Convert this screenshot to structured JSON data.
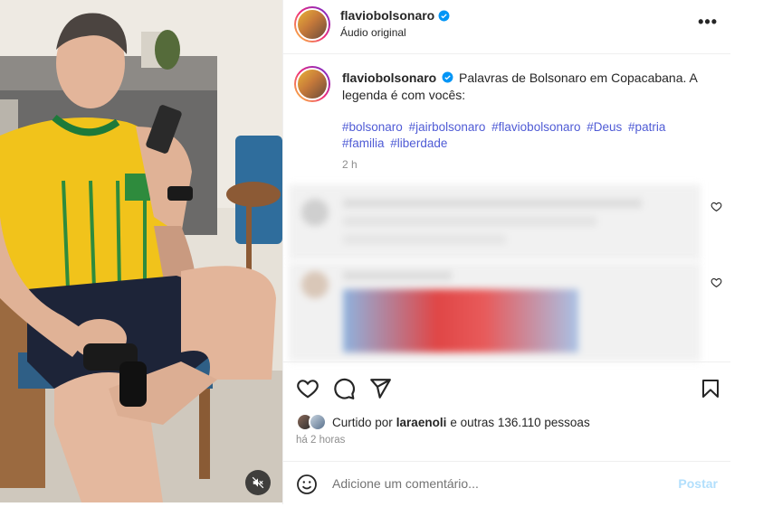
{
  "post": {
    "username": "flaviobolsonaro",
    "audio_label": "Áudio original",
    "more_label": "•••",
    "caption_text": "Palavras de Bolsonaro em Copacabana. A legenda é com vocês:",
    "hashtags": [
      "#bolsonaro",
      "#jairbolsonaro",
      "#flaviobolsonaro",
      "#Deus",
      "#patria",
      "#familia",
      "#liberdade"
    ],
    "caption_time": "2 h",
    "likes": {
      "prefix": "Curtido por",
      "user": "laraenoli",
      "suffix": "e outras 136.110 pessoas"
    },
    "posted_ago": "há 2 horas",
    "comment_placeholder": "Adicione um comentário...",
    "post_label": "Postar"
  },
  "colors": {
    "hashtag": "#4f5bd5",
    "verified": "#0095f6",
    "post_disabled": "#b2dffc",
    "secondary_text": "#8e8e8e"
  },
  "icons": [
    "verified-icon",
    "more-icon",
    "heart-icon",
    "comment-icon",
    "share-icon",
    "bookmark-icon",
    "emoji-icon",
    "mute-icon"
  ]
}
